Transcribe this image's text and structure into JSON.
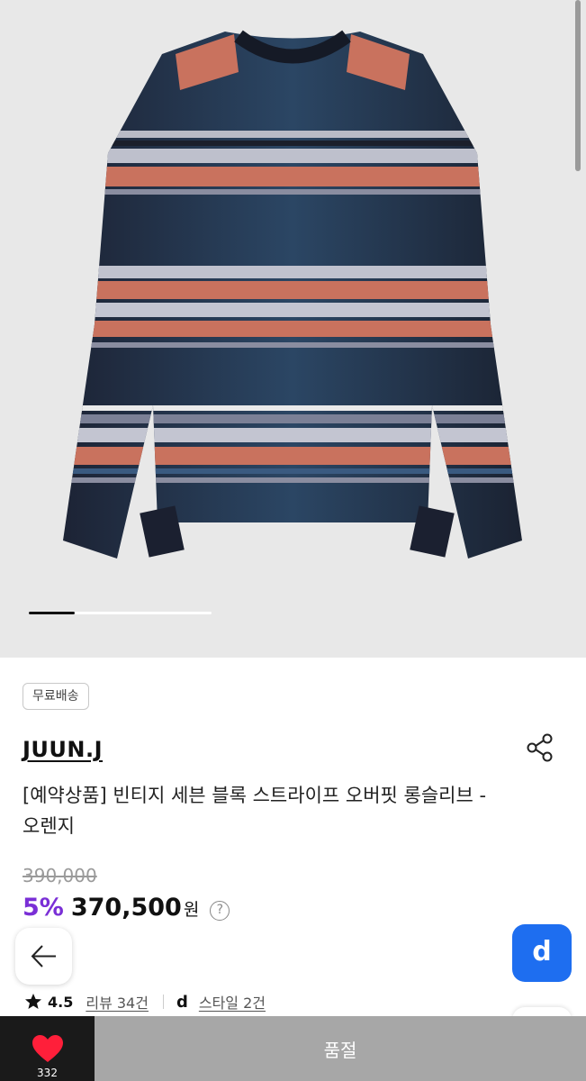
{
  "badge": "무료배송",
  "brand": "JUUN.J",
  "title": "[예약상품] 빈티지 세븐 블록 스트라이프 오버핏 롱슬리브 - 오렌지",
  "original_price": "390,000",
  "discount": "5%",
  "price": "370,500",
  "currency": "원",
  "help": "?",
  "rating": "4.5",
  "review_link": "리뷰 34건",
  "style_link": "스타일 2건",
  "d_button": "d",
  "d_logo": "d",
  "like_count": "332",
  "soldout_label": "품절",
  "image_index": 1,
  "image_count": 4,
  "colors": {
    "accent_purple": "#7a2fd6",
    "heart": "#ff1f3a",
    "d_blue": "#1e6ef0",
    "soldout_gray": "#a7a7a7"
  }
}
